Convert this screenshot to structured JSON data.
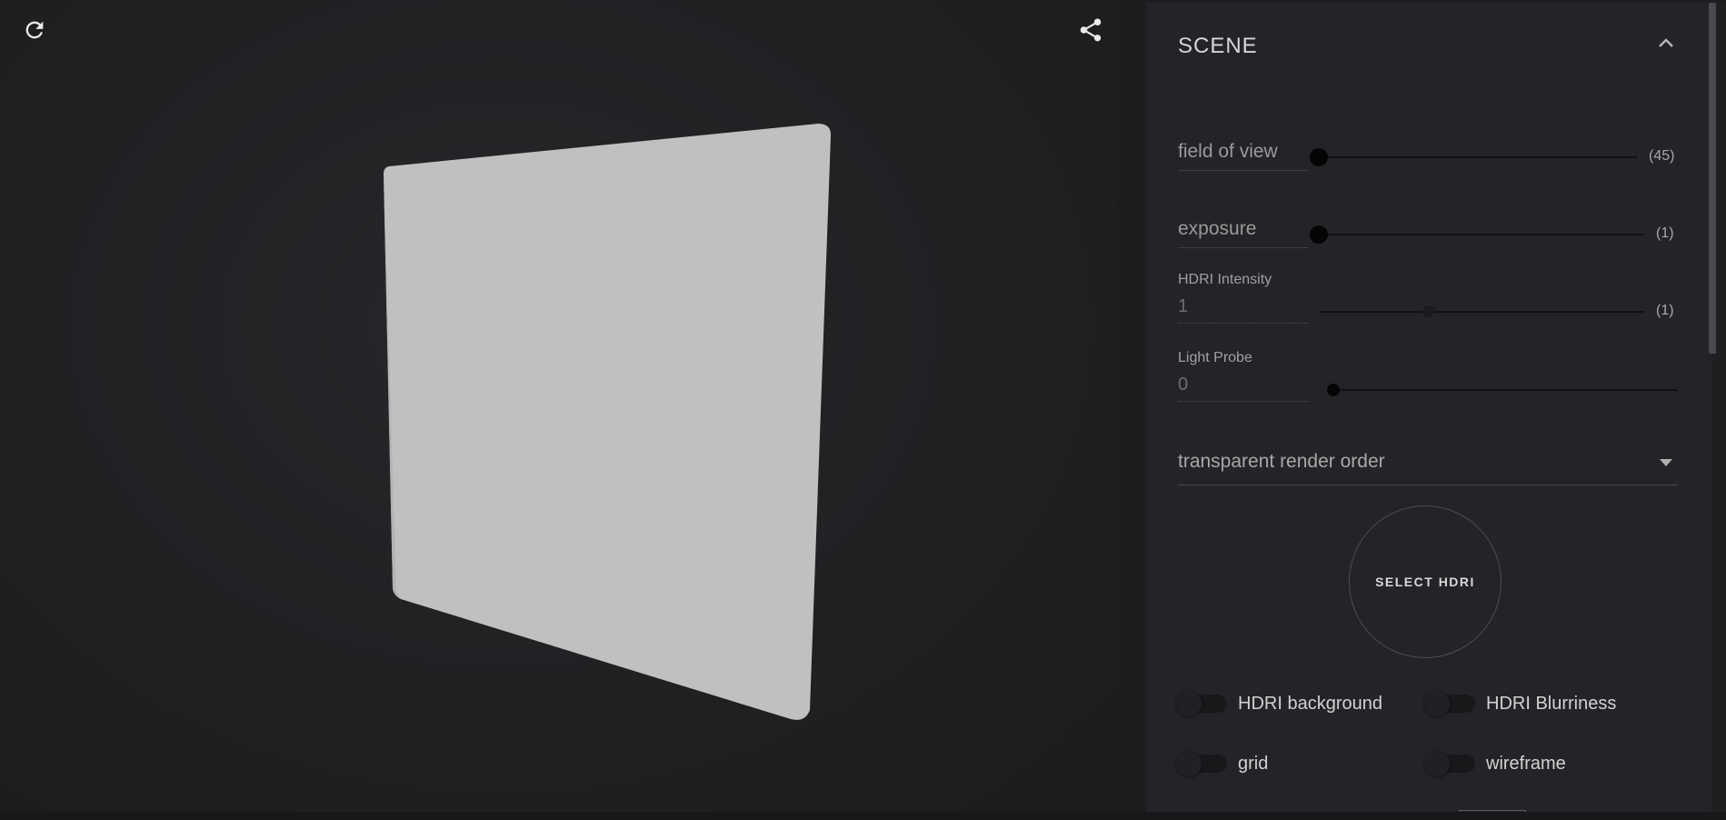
{
  "toolbar": {
    "reload_icon": "reload-icon",
    "share_icon": "share-icon"
  },
  "viewport": {
    "model_color": "#c0c0c0",
    "background_color": "#202123"
  },
  "panel": {
    "title": "SCENE",
    "collapse_icon": "chevron-up-icon",
    "field_of_view": {
      "label": "field of view",
      "value_text": "(45)",
      "level": 0
    },
    "exposure": {
      "label": "exposure",
      "value_text": "(1)",
      "level": 0
    },
    "hdri_intensity": {
      "label": "HDRI Intensity",
      "input_value": "1",
      "value_text": "(1)",
      "level": 0.33
    },
    "light_probe": {
      "label": "Light Probe",
      "input_value": "0",
      "level": 0
    },
    "render_order": {
      "label": "transparent render order"
    },
    "select_hdri": {
      "label": "SELECT HDRI"
    },
    "toggles": [
      {
        "label": "HDRI background",
        "on": false
      },
      {
        "label": "HDRI Blurriness",
        "on": false
      },
      {
        "label": "grid",
        "on": false
      },
      {
        "label": "wireframe",
        "on": false
      }
    ]
  },
  "colors": {
    "panel_bg": "#232427",
    "text": "#d6d6d6",
    "muted_text": "#9a9a9a"
  }
}
